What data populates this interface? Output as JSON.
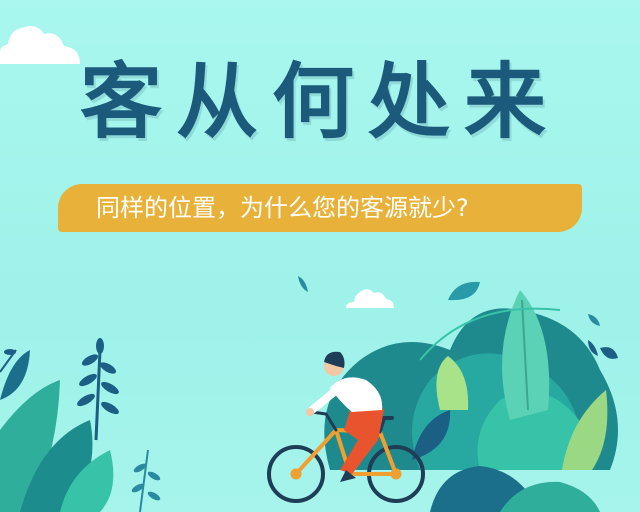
{
  "poster": {
    "title": "客从何处来",
    "subtitle": "同样的位置，为什么您的客源就少?"
  },
  "colors": {
    "background": "#a3f4eb",
    "title": "#1c5a7c",
    "banner": "#e8b23a",
    "banner_text": "#ffffff",
    "shirt": "#ffffff",
    "pants": "#e8542e",
    "bicycle": "#f0a030"
  }
}
